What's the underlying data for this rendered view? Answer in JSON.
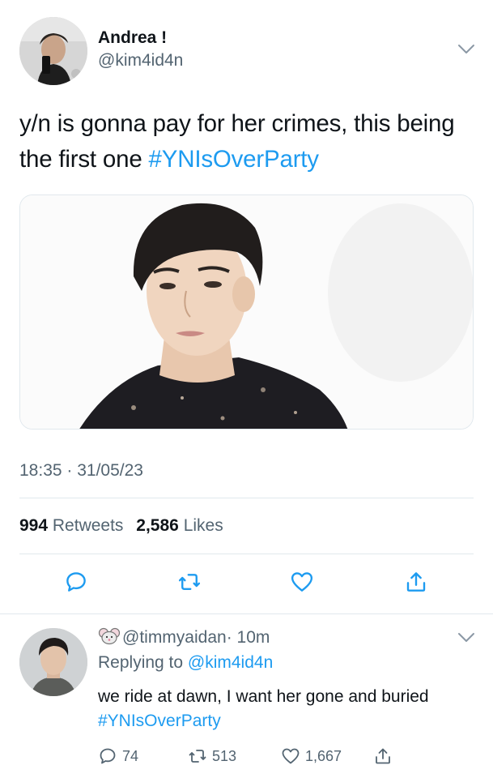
{
  "main_tweet": {
    "author": {
      "display_name": "Andrea !",
      "handle": "@kim4id4n"
    },
    "text": "y/n is gonna pay for her crimes, this being the first one ",
    "hashtag": "#YNIsOverParty",
    "timestamp": "18:35 · 31/05/23",
    "stats": {
      "retweets_count": "994",
      "retweets_label": "Retweets",
      "likes_count": "2,586",
      "likes_label": "Likes"
    },
    "actions": [
      "reply-icon",
      "retweet-icon",
      "heart-icon",
      "share-icon"
    ]
  },
  "reply": {
    "author": {
      "handle": "@timmyaidan",
      "time": "· 10m",
      "emoji_icon": "mouse-face-icon"
    },
    "replying_to_label": "Replying to ",
    "replying_to_handle": "@kim4id4n",
    "text": "we ride at dawn, I want her gone and buried ",
    "hashtag": "#YNIsOverParty",
    "actions": {
      "reply_count": "74",
      "retweet_count": "513",
      "like_count": "1,667"
    }
  },
  "colors": {
    "link": "#1d9bf0",
    "secondary": "#536471",
    "text": "#0f1419",
    "divider": "#e1e8ed"
  }
}
